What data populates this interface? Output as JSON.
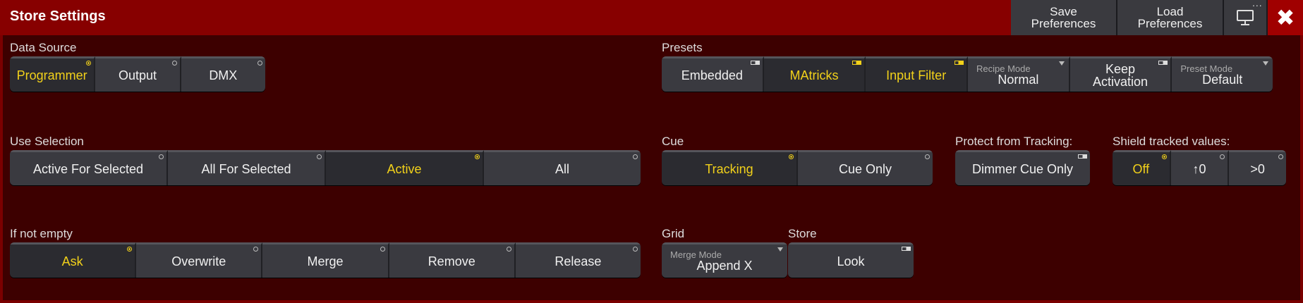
{
  "title": "Store Settings",
  "toolbar": {
    "save_label": "Save\nPreferences",
    "load_label": "Load\nPreferences",
    "more_label": "...",
    "close_label": "✖"
  },
  "data_source": {
    "label": "Data Source",
    "options": [
      "Programmer",
      "Output",
      "DMX"
    ],
    "selected": "Programmer"
  },
  "presets": {
    "label": "Presets",
    "embedded": "Embedded",
    "matricks": "MAtricks",
    "input_filter": "Input Filter",
    "recipe_mode_label": "Recipe Mode",
    "recipe_mode_value": "Normal",
    "keep_activation": "Keep\nActivation",
    "preset_mode_label": "Preset Mode",
    "preset_mode_value": "Default"
  },
  "use_selection": {
    "label": "Use Selection",
    "options": [
      "Active For Selected",
      "All For Selected",
      "Active",
      "All"
    ],
    "selected": "Active"
  },
  "cue": {
    "label": "Cue",
    "options": [
      "Tracking",
      "Cue Only"
    ],
    "selected": "Tracking"
  },
  "protect_from_tracking": {
    "label": "Protect from Tracking:",
    "value": "Dimmer Cue Only"
  },
  "shield_tracked_values": {
    "label": "Shield tracked values:",
    "options": [
      "Off",
      "↑0",
      ">0"
    ],
    "selected": "Off"
  },
  "if_not_empty": {
    "label": "If not empty",
    "options": [
      "Ask",
      "Overwrite",
      "Merge",
      "Remove",
      "Release"
    ],
    "selected": "Ask"
  },
  "grid": {
    "label": "Grid",
    "merge_mode_label": "Merge Mode",
    "merge_mode_value": "Append X"
  },
  "store": {
    "label": "Store",
    "look": "Look"
  },
  "colors": {
    "background": "#7a0000",
    "panel": "#3d0000",
    "active_text": "#f2d11a",
    "button": "#3a3a40"
  }
}
